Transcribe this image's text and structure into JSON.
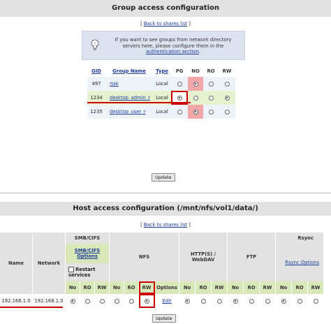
{
  "group_section": {
    "title": "Group access configuration",
    "back_link": "Back to shares list",
    "info_text": "If you want to see groups from network directory servers here, please configure them in the",
    "info_link": "authentication section",
    "columns": [
      "GID",
      "Group Name",
      "Type",
      "PG",
      "NO",
      "RO",
      "RW"
    ],
    "rows": [
      {
        "gid": "497",
        "name": "rjak",
        "type": "Local",
        "selected": "NO"
      },
      {
        "gid": "1234",
        "name": "desktop_admin_r",
        "type": "Local",
        "selected": "PG"
      },
      {
        "gid": "1235",
        "name": "desktop_user_r",
        "type": "Local",
        "selected": "NO"
      }
    ],
    "update_label": "Update"
  },
  "host_section": {
    "title": "Host access configuration (/mnt/nfs/vol1/data/)",
    "back_link": "Back to shares list",
    "headers": {
      "name": "Name",
      "network": "Network",
      "smb": "SMB/CIFS",
      "smb_options": "SMB/CIFS Options",
      "restart": "Restart services",
      "nfs": "NFS",
      "http": "HTTP(S) / WebDAV",
      "ftp": "FTP",
      "rsync": "Rsync",
      "rsync_options": "Rsync Options"
    },
    "perm_labels": {
      "no": "No",
      "ro": "RO",
      "rw": "RW",
      "options": "Options"
    },
    "row": {
      "name": "192.168.1.0",
      "network": "192.168.1.0",
      "edit": "Edit"
    },
    "update_label": "Update"
  },
  "colors": {
    "accent_link": "#1a3c9a",
    "highlight_red": "#cc0000",
    "selected_pink": "#f2a8a8",
    "row_green": "#e6f2cf"
  }
}
